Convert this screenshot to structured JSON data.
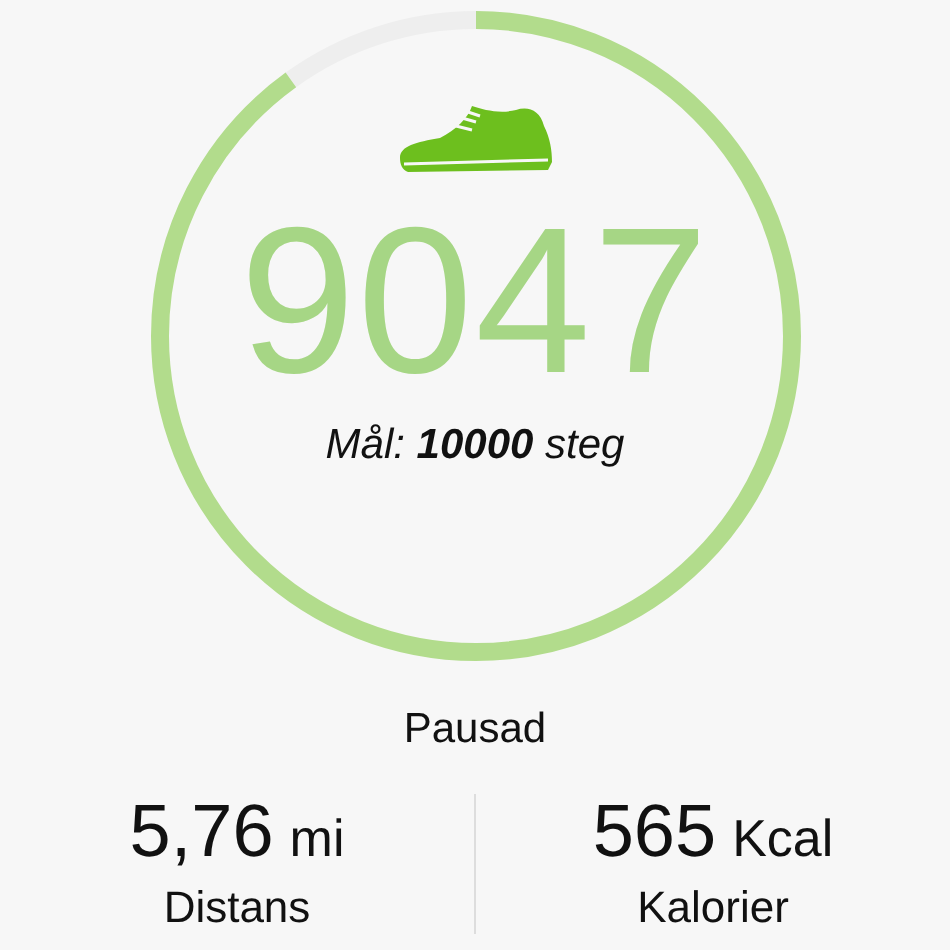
{
  "progress": {
    "level": 0.9,
    "steps": "9047",
    "goal": "Mål: **10000** steg"
  },
  "status": "Pausad",
  "stats": [
    {
      "value": "5,76",
      "unit": "mi",
      "label": "Distans"
    },
    {
      "value": "565",
      "unit": "Kcal",
      "label": "Kalorier"
    }
  ]
}
